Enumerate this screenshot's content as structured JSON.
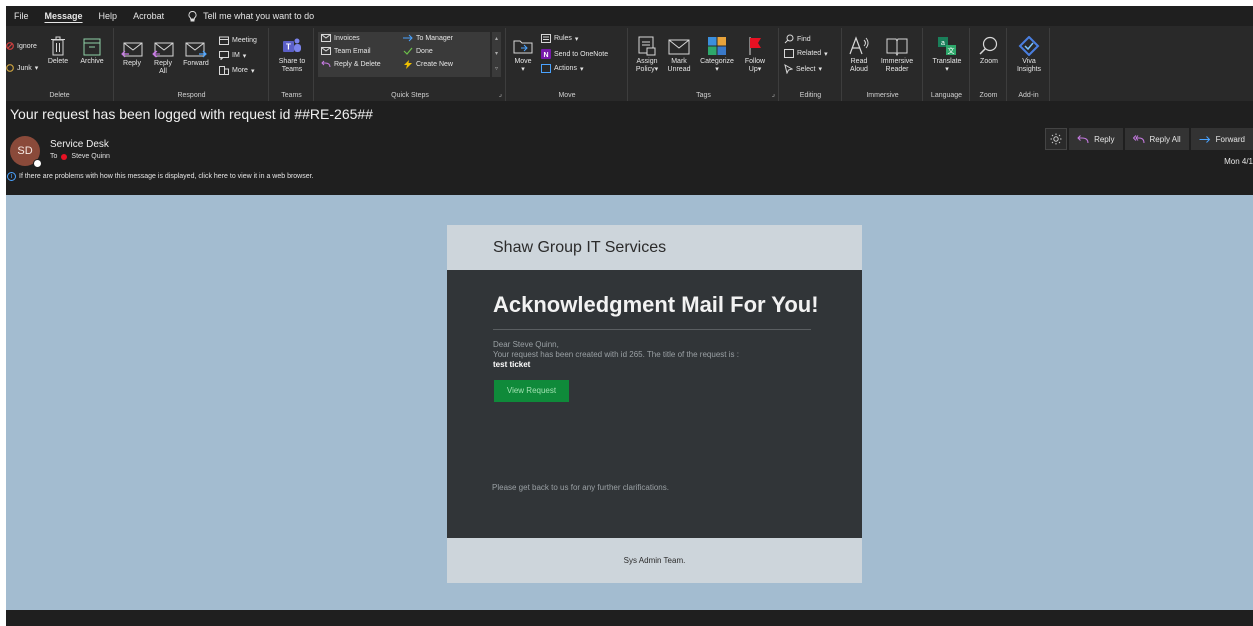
{
  "menu": {
    "items": [
      "File",
      "Message",
      "Help",
      "Acrobat"
    ],
    "active": "Message",
    "tell_me": "Tell me what you want to do"
  },
  "ribbon": {
    "delete_group": {
      "label": "Delete",
      "ignore": "Ignore",
      "junk": "Junk",
      "delete": "Delete",
      "archive": "Archive"
    },
    "respond_group": {
      "label": "Respond",
      "reply": "Reply",
      "reply_all_1": "Reply",
      "reply_all_2": "All",
      "forward": "Forward",
      "meeting": "Meeting",
      "im": "IM",
      "more": "More"
    },
    "teams_group": {
      "label": "Teams",
      "share_1": "Share to",
      "share_2": "Teams"
    },
    "quicksteps_group": {
      "label": "Quick Steps",
      "invoices": "Invoices",
      "team_email": "Team Email",
      "reply_delete": "Reply & Delete",
      "to_manager": "To Manager",
      "done": "Done",
      "create_new": "Create New"
    },
    "move_group": {
      "label": "Move",
      "move": "Move",
      "rules": "Rules",
      "onenote": "Send to OneNote",
      "actions": "Actions"
    },
    "tags_group": {
      "label": "Tags",
      "assign_1": "Assign",
      "assign_2": "Policy",
      "mark_1": "Mark",
      "mark_2": "Unread",
      "categorize": "Categorize",
      "follow_1": "Follow",
      "follow_2": "Up"
    },
    "editing_group": {
      "label": "Editing",
      "find": "Find",
      "related": "Related",
      "select": "Select"
    },
    "immersive_group": {
      "label": "Immersive",
      "read_1": "Read",
      "read_2": "Aloud",
      "immersive_1": "Immersive",
      "immersive_2": "Reader"
    },
    "language_group": {
      "label": "Language",
      "translate": "Translate"
    },
    "zoom_group": {
      "label": "Zoom",
      "zoom": "Zoom"
    },
    "addin_group": {
      "label": "Add-in",
      "viva_1": "Viva",
      "viva_2": "Insights"
    }
  },
  "message": {
    "subject": "Your request has been logged with request id ##RE-265##",
    "avatar_initials": "SD",
    "sender": "Service Desk",
    "to_label": "To",
    "recipient": "Steve Quinn",
    "info": "If there are problems with how this message is displayed, click here to view it in a web browser.",
    "actions": {
      "reply": "Reply",
      "reply_all": "Reply All",
      "forward": "Forward"
    },
    "date": "Mon 4/1"
  },
  "email": {
    "header": "Shaw Group IT Services",
    "heading": "Acknowledgment Mail For You!",
    "greeting": "Dear Steve Quinn,",
    "line": "Your request has been created with id 265. The title of the request is :",
    "request_title": "test ticket",
    "button": "View Request",
    "further": "Please get back to us for any further clarifications.",
    "footer": "Sys Admin Team."
  },
  "colors": {
    "app_bg": "#1f1f1f",
    "ribbon_bg": "#292929",
    "body_bg": "#a3bcd0",
    "card_dark": "#313538",
    "card_light": "#cdd5db",
    "button_green": "#0f8a3a",
    "presence_red": "#e81123"
  }
}
